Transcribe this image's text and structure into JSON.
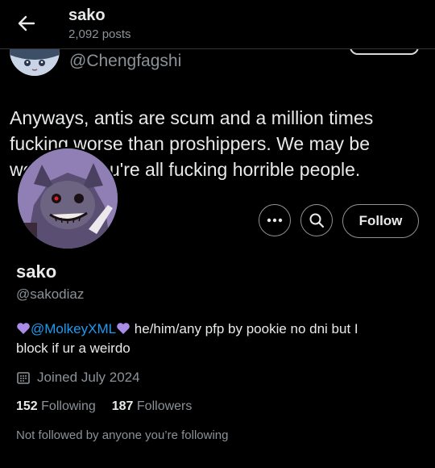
{
  "header": {
    "name": "sako",
    "post_count": "2,092 posts",
    "back_icon": "arrow-left-icon"
  },
  "banner": {
    "handle": "@Chengfagshi",
    "post_text_line1": "Anyways, antis are scum and a million times",
    "post_text_line2": "fucking worse than proshippers. We may be",
    "post_text_line3": "weird but you're all fucking horrible people."
  },
  "actions": {
    "more_icon": "more-dots-icon",
    "search_icon": "search-icon",
    "follow_label": "Follow"
  },
  "profile": {
    "display_name": "sako",
    "username": "@sakodiaz",
    "bio_mention": "@MolkeyXML",
    "bio_text_line1": " he/him/any pfp by pookie no dni but I",
    "bio_text_line2": "block if ur a weirdo",
    "joined": "Joined July 2024",
    "following_count": "152",
    "following_label": "Following",
    "followers_count": "187",
    "followers_label": "Followers",
    "not_followed": "Not followed by anyone you’re following"
  },
  "colors": {
    "background": "#000000",
    "text": "#e7e9ea",
    "secondary_text": "#8b9298",
    "link": "#1d9bf0",
    "heart": "#a98be8"
  }
}
